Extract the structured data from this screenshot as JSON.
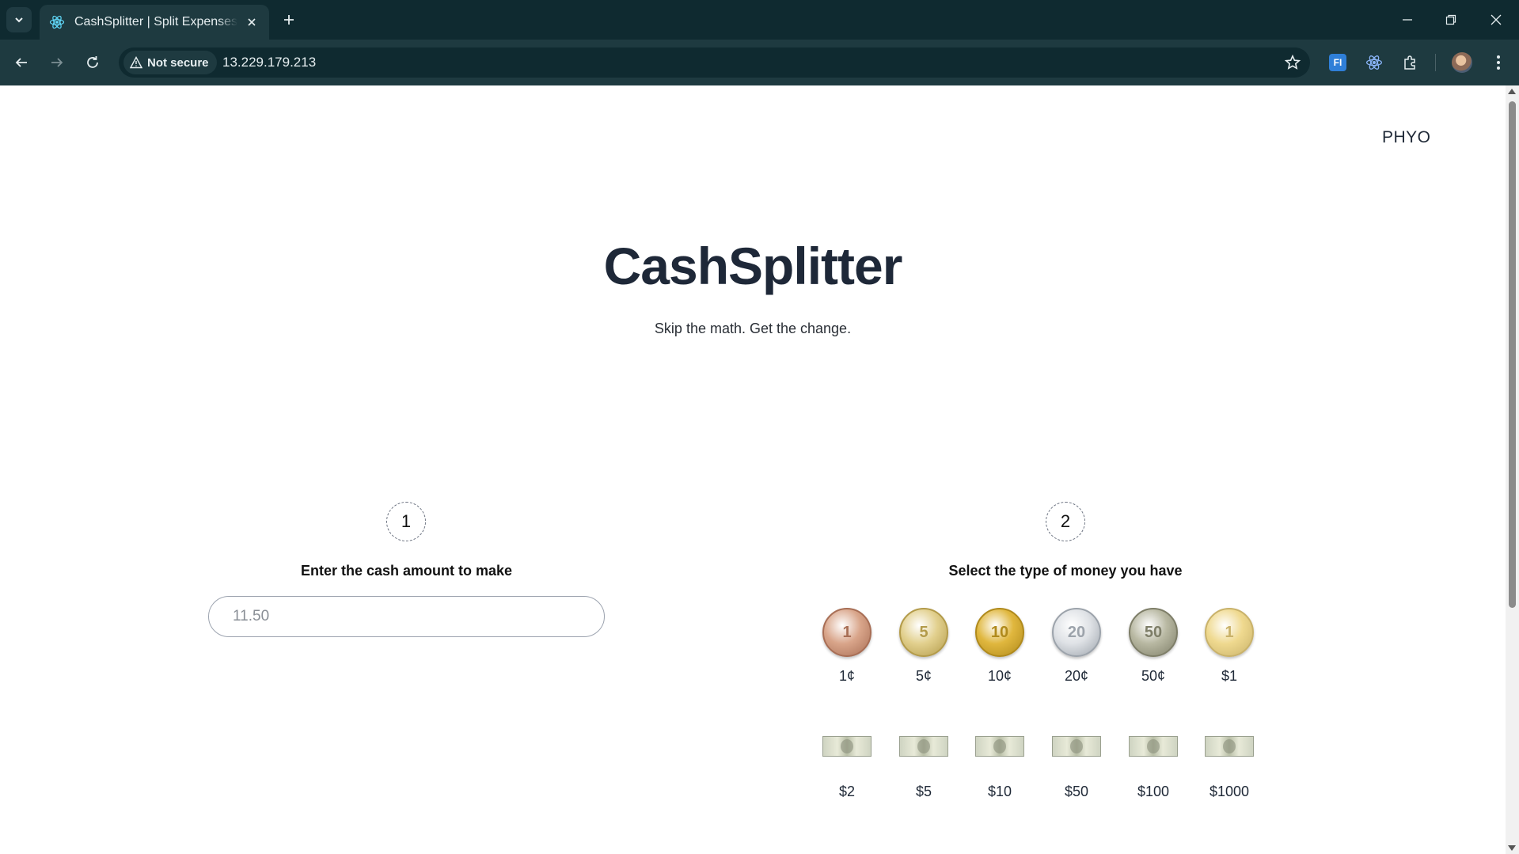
{
  "browser": {
    "tab_title": "CashSplitter | Split Expenses Effortlessly",
    "security_label": "Not secure",
    "url": "13.229.179.213",
    "accent": "#0f2a30",
    "toolbar_color": "#1e3a40"
  },
  "page": {
    "user_name": "PHYO",
    "title": "CashSplitter",
    "subtitle": "Skip the math. Get the change."
  },
  "step1": {
    "number": "1",
    "label": "Enter the cash amount to make",
    "input_value": "",
    "input_placeholder": "11.50"
  },
  "step2": {
    "number": "2",
    "label": "Select the type of money you have",
    "coins": [
      {
        "label": "1¢",
        "face": "1",
        "color": "#d9a58a",
        "edge": "#a86e55",
        "icon": "coin-1c-icon"
      },
      {
        "label": "5¢",
        "face": "5",
        "color": "#e2d08e",
        "edge": "#b39b4a",
        "icon": "coin-5c-icon"
      },
      {
        "label": "10¢",
        "face": "10",
        "color": "#e0b73e",
        "edge": "#b08a1c",
        "icon": "coin-10c-icon"
      },
      {
        "label": "20¢",
        "face": "20",
        "color": "#dfe2e6",
        "edge": "#9ca3ab",
        "icon": "coin-20c-icon"
      },
      {
        "label": "50¢",
        "face": "50",
        "color": "#b8b8a2",
        "edge": "#7e7e68",
        "icon": "coin-50c-icon"
      },
      {
        "label": "$1",
        "face": "1",
        "color": "#efd98f",
        "edge": "#c9b26a",
        "icon": "coin-1-dollar-icon"
      }
    ],
    "notes": [
      {
        "label": "$2",
        "icon": "note-2-dollar-icon"
      },
      {
        "label": "$5",
        "icon": "note-5-dollar-icon"
      },
      {
        "label": "$10",
        "icon": "note-10-dollar-icon"
      },
      {
        "label": "$50",
        "icon": "note-50-dollar-icon"
      },
      {
        "label": "$100",
        "icon": "note-100-dollar-icon"
      },
      {
        "label": "$1000",
        "icon": "note-1000-dollar-icon"
      }
    ]
  }
}
